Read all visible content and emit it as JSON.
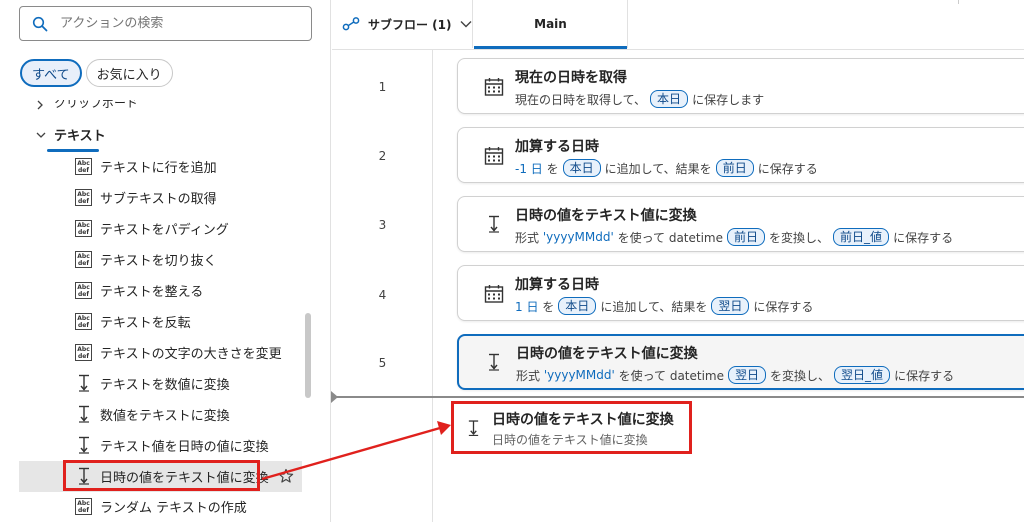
{
  "search": {
    "placeholder": "アクションの検索"
  },
  "filters": {
    "all": "すべて",
    "favorites": "お気に入り"
  },
  "tree": {
    "prev_group_cut": "クリップボード",
    "group": "テキスト",
    "items": [
      {
        "label": "テキストに行を追加",
        "icon": "abc-def-icon"
      },
      {
        "label": "サブテキストの取得",
        "icon": "abc-def-icon"
      },
      {
        "label": "テキストをパディング",
        "icon": "abc-def-icon"
      },
      {
        "label": "テキストを切り抜く",
        "icon": "abc-def-icon"
      },
      {
        "label": "テキストを整える",
        "icon": "abc-def-icon"
      },
      {
        "label": "テキストを反転",
        "icon": "abc-def-icon"
      },
      {
        "label": "テキストの文字の大きさを変更",
        "icon": "abc-def-icon"
      },
      {
        "label": "テキストを数値に変換",
        "icon": "convert-icon"
      },
      {
        "label": "数値をテキストに変換",
        "icon": "convert-icon"
      },
      {
        "label": "テキスト値を日時の値に変換",
        "icon": "convert-icon"
      },
      {
        "label": "日時の値をテキスト値に変換",
        "icon": "convert-icon"
      },
      {
        "label": "ランダム テキストの作成",
        "icon": "abc-def-icon"
      }
    ]
  },
  "topbar": {
    "subflow": "サブフロー (1)",
    "main_tab": "Main"
  },
  "flow": {
    "rows": [
      {
        "num": "1",
        "title": "現在の日時を取得",
        "d1": "現在の日時を取得して、",
        "p1": "本日",
        "d2": "に保存します"
      },
      {
        "num": "2",
        "title": "加算する日時",
        "v1": "-1 日",
        "d1": "を",
        "p1": "本日",
        "d2": "に追加して、結果を",
        "p2": "前日",
        "d3": "に保存する"
      },
      {
        "num": "3",
        "title": "日時の値をテキスト値に変換",
        "d1": "形式",
        "v1": "'yyyyMMdd'",
        "d2": "を使って datetime",
        "p1": "前日",
        "d3": "を変換し、",
        "p2": "前日_値",
        "d4": "に保存する"
      },
      {
        "num": "4",
        "title": "加算する日時",
        "v1": "1 日",
        "d1": "を",
        "p1": "本日",
        "d2": "に追加して、結果を",
        "p2": "翌日",
        "d3": "に保存する"
      },
      {
        "num": "5",
        "title": "日時の値をテキスト値に変換",
        "d1": "形式",
        "v1": "'yyyyMMdd'",
        "d2": "を使って datetime",
        "p1": "翌日",
        "d3": "を変換し、",
        "p2": "翌日_値",
        "d4": "に保存する"
      }
    ],
    "drag": {
      "title": "日時の値をテキスト値に変換",
      "desc": "日時の値をテキスト値に変換"
    }
  },
  "colors": {
    "accent": "#0f6cbd",
    "annotation": "#e0211d"
  }
}
